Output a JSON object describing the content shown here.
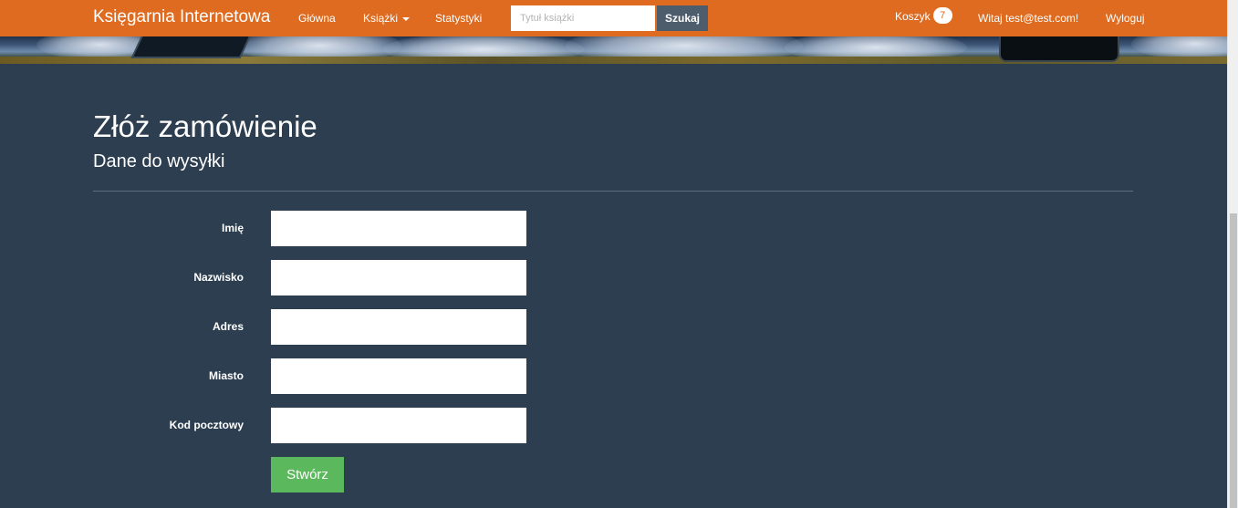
{
  "navbar": {
    "brand": "Księgarnia Internetowa",
    "links": {
      "home": "Główna",
      "books": "Książki",
      "stats": "Statystyki"
    },
    "search": {
      "placeholder": "Tytuł książki",
      "value": "",
      "button_label": "Szukaj"
    },
    "cart": {
      "label": "Koszyk",
      "count": "7"
    },
    "greeting": "Witaj test@test.com!",
    "logout": "Wyloguj"
  },
  "page": {
    "title": "Złóż zamówienie",
    "subtitle": "Dane do wysyłki"
  },
  "form": {
    "fields": [
      {
        "label": "Imię",
        "value": ""
      },
      {
        "label": "Nazwisko",
        "value": ""
      },
      {
        "label": "Adres",
        "value": ""
      },
      {
        "label": "Miasto",
        "value": ""
      },
      {
        "label": "Kod pocztowy",
        "value": ""
      }
    ],
    "submit_label": "Stwórz"
  },
  "colors": {
    "navbar": "#de6b1f",
    "background": "#2c3e50",
    "search_button": "#4e5d6c",
    "submit_button": "#5cb85c"
  },
  "icons": {
    "books_dropdown": "caret-down-icon"
  }
}
